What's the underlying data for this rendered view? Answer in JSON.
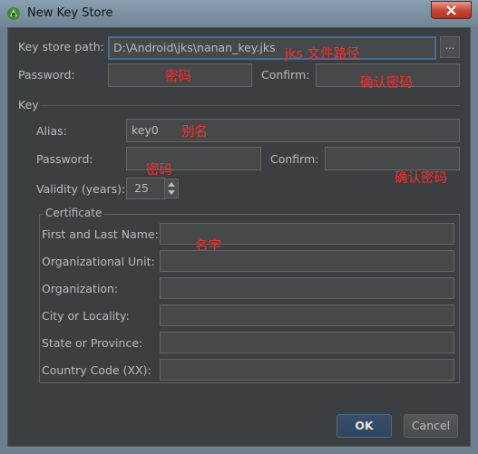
{
  "window": {
    "title": "New Key Store"
  },
  "keystore": {
    "path_label": "Key store path:",
    "path_value": "D:\\Android\\jks\\nanan_key.jks",
    "browse_label": "...",
    "password_label": "Password:",
    "confirm_label": "Confirm:"
  },
  "key_section": {
    "heading": "Key",
    "alias_label": "Alias:",
    "alias_value": "key0",
    "password_label": "Password:",
    "confirm_label": "Confirm:",
    "validity_label": "Validity (years):",
    "validity_value": "25"
  },
  "certificate": {
    "legend": "Certificate",
    "fields": [
      {
        "label": "First and Last Name:",
        "value": ""
      },
      {
        "label": "Organizational Unit:",
        "value": ""
      },
      {
        "label": "Organization:",
        "value": ""
      },
      {
        "label": "City or Locality:",
        "value": ""
      },
      {
        "label": "State or Province:",
        "value": ""
      },
      {
        "label": "Country Code (XX):",
        "value": ""
      }
    ]
  },
  "annotations": {
    "jks_path": "jks 文件路径",
    "password": "密码",
    "confirm_password": "确认密码",
    "alias": "别名",
    "key_password": "密码",
    "key_confirm": "确认密码",
    "name": "名字"
  },
  "buttons": {
    "ok": "OK",
    "cancel": "Cancel"
  },
  "colors": {
    "accent": "#466d94",
    "annotation": "#ff2a2a",
    "background": "#3c3f41"
  }
}
